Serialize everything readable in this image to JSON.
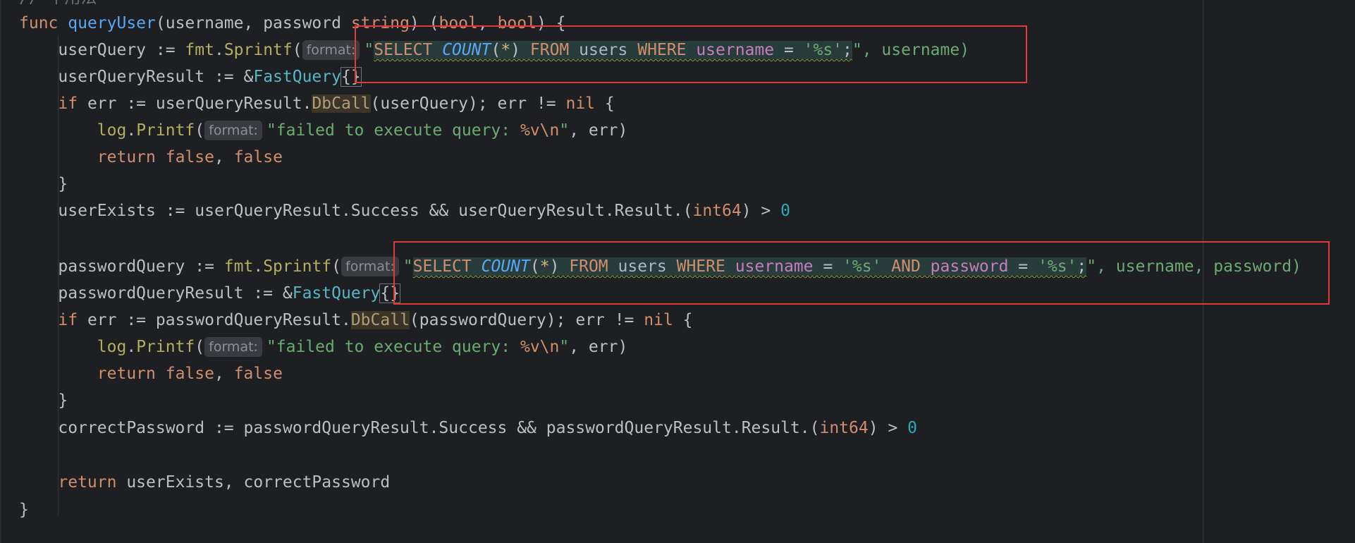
{
  "code": {
    "top_comment": "// 平用法",
    "func_kw": "func",
    "func_name": "queryUser",
    "params_open": "(username, password ",
    "param_type": "string",
    "params_close": ") (",
    "ret_type1": "bool",
    "ret_sep": ", ",
    "ret_type2": "bool",
    "ret_close": ") {",
    "indent1": "    ",
    "indent2": "        ",
    "userQuery_var": "userQuery := ",
    "fmt_pkg": "fmt",
    "dot": ".",
    "sprintf": "Sprintf",
    "paren_open": "(",
    "hint_format": "format:",
    "quote": "\"",
    "sql_select": "SELECT ",
    "sql_count": "COUNT",
    "sql_lparen": "(",
    "sql_star": "*",
    "sql_rparen": ") ",
    "sql_from": "FROM ",
    "sql_users": "users ",
    "sql_where": "WHERE ",
    "sql_username": "username",
    "sql_eq": " = ",
    "sql_s1": "'%s'",
    "sql_and": " AND ",
    "sql_password": "password",
    "sql_semicolon": ";",
    "userQuery_tail": "\", username)",
    "userQueryResult_var": "userQueryResult := &",
    "fastquery": "FastQuery",
    "braces": "{}",
    "if_kw": "if",
    "err_assign_user": " err := userQueryResult.",
    "dbcall": "DbCall",
    "userQuery_arg": "(userQuery); err != ",
    "nil": "nil",
    "brace_open": " {",
    "log_pkg": "log",
    "printf": "Printf",
    "fail_str": "\"failed to execute query: ",
    "fail_fmt": "%v\\n",
    "fail_close_quote": "\"",
    "fail_tail": ", err)",
    "return_kw": "return",
    "false_kw": "false",
    "comma_sp": ", ",
    "close_brace": "}",
    "userExists_line": "userExists := userQueryResult.Success && userQueryResult.Result.(",
    "int64": "int64",
    "gt_zero": ") > ",
    "zero": "0",
    "passwordQuery_var": "passwordQuery := ",
    "passwordQuery_tail": "\", username, password)",
    "passwordQueryResult_var": "passwordQueryResult := &",
    "err_assign_pass": " err := passwordQueryResult.",
    "passwordQuery_arg": "(passwordQuery); err != ",
    "correctPassword_line": "correctPassword := passwordQueryResult.Success && passwordQueryResult.Result.(",
    "return_line_tail": " userExists, correctPassword"
  },
  "colors": {
    "background": "#1e1f22",
    "highlight_box": "#e03a3a",
    "keyword": "#cf8e6d",
    "function": "#56a8f5",
    "string": "#6aab73"
  }
}
